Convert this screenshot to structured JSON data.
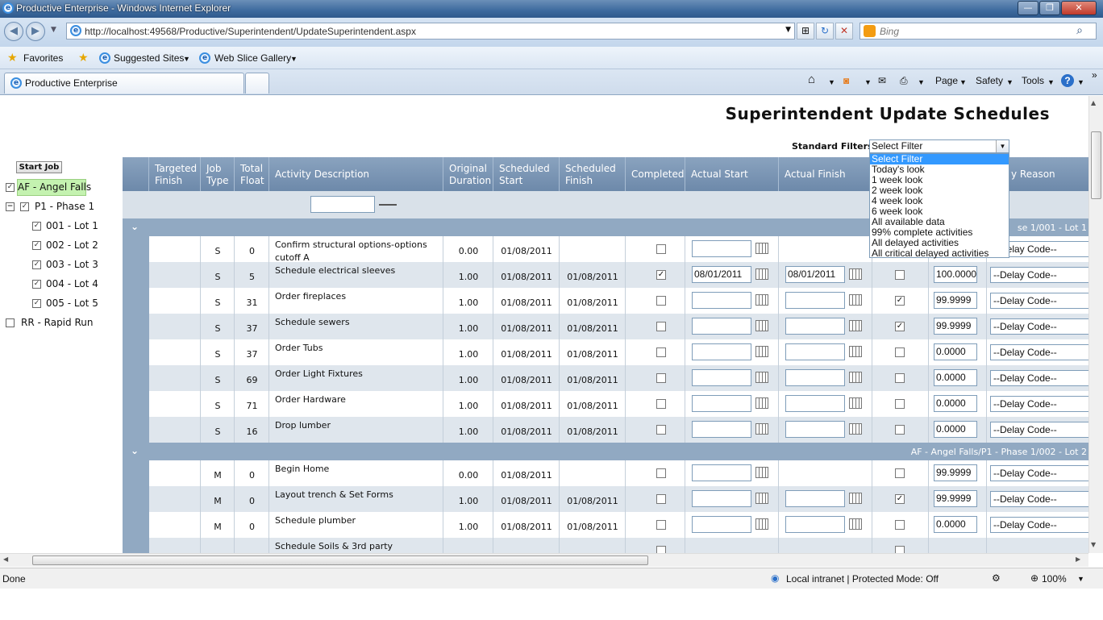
{
  "window": {
    "title": "Productive Enterprise - Windows Internet Explorer",
    "min": "—",
    "max": "❐",
    "close": "✕"
  },
  "address": {
    "url": "http://localhost:49568/Productive/Superintendent/UpdateSuperintendent.aspx",
    "search_placeholder": "Bing"
  },
  "favorites": {
    "favorites": "Favorites",
    "suggested": "Suggested Sites",
    "webslice": "Web Slice Gallery"
  },
  "tab": {
    "label": "Productive Enterprise"
  },
  "toolbar": {
    "page": "Page",
    "safety": "Safety",
    "tools": "Tools",
    "help": "?"
  },
  "page": {
    "title": "Superintendent Update Schedules",
    "filter_label": "Standard Filters",
    "filter_value": "Select Filter",
    "filter_options": [
      "Select Filter",
      "Today's look",
      "1 week look",
      "2 week look",
      "4 week look",
      "6 week look",
      "All available data",
      "99% complete activities",
      "All delayed activities",
      "All critical delayed activities"
    ],
    "start_job": "Start Job"
  },
  "tree": [
    {
      "label": "AF - Angel Falls",
      "checked": "✓"
    },
    {
      "label": "P1 - Phase 1",
      "checked": "✓",
      "expander": "−"
    },
    {
      "label": "001 - Lot 1",
      "checked": "✓"
    },
    {
      "label": "002 - Lot 2",
      "checked": "✓"
    },
    {
      "label": "003 - Lot 3",
      "checked": "✓"
    },
    {
      "label": "004 - Lot 4",
      "checked": "✓"
    },
    {
      "label": "005 - Lot 5",
      "checked": "✓"
    },
    {
      "label": "RR - Rapid Run",
      "checked": ""
    }
  ],
  "grid": {
    "headers": {
      "targeted_finish": "Targeted Finish",
      "job_type": "Job Type",
      "total_float": "Total Float",
      "activity": "Activity Description",
      "orig_duration": "Original Duration",
      "sched_start": "Scheduled Start",
      "sched_finish": "Scheduled Finish",
      "completed": "Completed",
      "actual_start": "Actual Start",
      "actual_finish": "Actual Finish",
      "delay_reason": "y Reason"
    },
    "groups": [
      {
        "label": "se 1/001 - Lot 1"
      },
      {
        "label": "AF - Angel Falls/P1 - Phase 1/002 - Lot 2"
      }
    ],
    "rows": [
      {
        "type": "S",
        "float": "0",
        "desc": "Confirm structural options-options",
        "desc2": "cutoff A",
        "dur": "0.00",
        "start": "01/08/2011",
        "finish": "",
        "completed": "",
        "astart": "",
        "afinish": "",
        "done": "",
        "pct": "",
        "delay": "--Delay Code--"
      },
      {
        "type": "S",
        "float": "5",
        "desc": "Schedule electrical sleeves",
        "desc2": "",
        "dur": "1.00",
        "start": "01/08/2011",
        "finish": "01/08/2011",
        "completed": "✓",
        "astart": "08/01/2011",
        "afinish": "08/01/2011",
        "done": "",
        "pct": "100.0000",
        "delay": "--Delay Code--"
      },
      {
        "type": "S",
        "float": "31",
        "desc": "Order fireplaces",
        "desc2": "",
        "dur": "1.00",
        "start": "01/08/2011",
        "finish": "01/08/2011",
        "completed": "",
        "astart": "",
        "afinish": "",
        "done": "✓",
        "pct": "99.9999",
        "delay": "--Delay Code--"
      },
      {
        "type": "S",
        "float": "37",
        "desc": "Schedule sewers",
        "desc2": "",
        "dur": "1.00",
        "start": "01/08/2011",
        "finish": "01/08/2011",
        "completed": "",
        "astart": "",
        "afinish": "",
        "done": "✓",
        "pct": "99.9999",
        "delay": "--Delay Code--"
      },
      {
        "type": "S",
        "float": "37",
        "desc": "Order Tubs",
        "desc2": "",
        "dur": "1.00",
        "start": "01/08/2011",
        "finish": "01/08/2011",
        "completed": "",
        "astart": "",
        "afinish": "",
        "done": "",
        "pct": "0.0000",
        "delay": "--Delay Code--"
      },
      {
        "type": "S",
        "float": "69",
        "desc": "Order Light Fixtures",
        "desc2": "",
        "dur": "1.00",
        "start": "01/08/2011",
        "finish": "01/08/2011",
        "completed": "",
        "astart": "",
        "afinish": "",
        "done": "",
        "pct": "0.0000",
        "delay": "--Delay Code--"
      },
      {
        "type": "S",
        "float": "71",
        "desc": "Order Hardware",
        "desc2": "",
        "dur": "1.00",
        "start": "01/08/2011",
        "finish": "01/08/2011",
        "completed": "",
        "astart": "",
        "afinish": "",
        "done": "",
        "pct": "0.0000",
        "delay": "--Delay Code--"
      },
      {
        "type": "S",
        "float": "16",
        "desc": "Drop lumber",
        "desc2": "",
        "dur": "1.00",
        "start": "01/08/2011",
        "finish": "01/08/2011",
        "completed": "",
        "astart": "",
        "afinish": "",
        "done": "",
        "pct": "0.0000",
        "delay": "--Delay Code--"
      },
      {
        "type": "M",
        "float": "0",
        "desc": "Begin Home",
        "desc2": "",
        "dur": "0.00",
        "start": "01/08/2011",
        "finish": "",
        "completed": "",
        "astart": "",
        "afinish": "",
        "done": "",
        "pct": "99.9999",
        "delay": "--Delay Code--"
      },
      {
        "type": "M",
        "float": "0",
        "desc": "Layout trench & Set Forms",
        "desc2": "",
        "dur": "1.00",
        "start": "01/08/2011",
        "finish": "01/08/2011",
        "completed": "",
        "astart": "",
        "afinish": "",
        "done": "✓",
        "pct": "99.9999",
        "delay": "--Delay Code--"
      },
      {
        "type": "M",
        "float": "0",
        "desc": "Schedule plumber",
        "desc2": "",
        "dur": "1.00",
        "start": "01/08/2011",
        "finish": "01/08/2011",
        "completed": "",
        "astart": "",
        "afinish": "",
        "done": "",
        "pct": "0.0000",
        "delay": "--Delay Code--"
      },
      {
        "type": "",
        "float": "",
        "desc": "Schedule Soils & 3rd party",
        "desc2": "",
        "dur": "",
        "start": "",
        "finish": "",
        "completed": "",
        "astart": "",
        "afinish": "",
        "done": "",
        "pct": "",
        "delay": ""
      }
    ]
  },
  "status": {
    "done": "Done",
    "zone": "Local intranet | Protected Mode: Off",
    "zoom": "100%"
  }
}
